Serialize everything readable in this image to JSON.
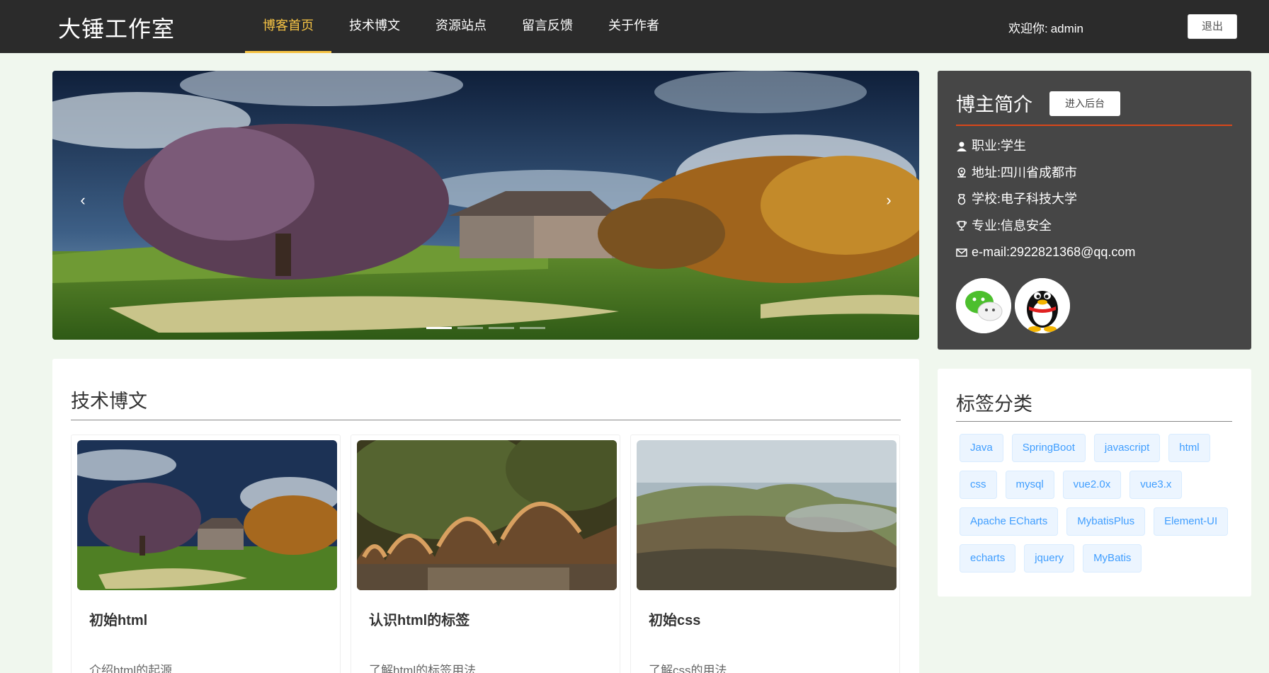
{
  "header": {
    "brand": "大锤工作室",
    "nav": [
      "博客首页",
      "技术博文",
      "资源站点",
      "留言反馈",
      "关于作者"
    ],
    "active_index": 0,
    "welcome_label": "欢迎你:",
    "username": "admin",
    "logout_label": "退出",
    "accent_color": "#f6c344"
  },
  "carousel": {
    "prev_glyph": "‹",
    "next_glyph": "›",
    "slides": 4,
    "active_slide": 1
  },
  "profile": {
    "title": "博主简介",
    "admin_button": "进入后台",
    "items": [
      {
        "icon": "user-icon",
        "text": "职业:学生"
      },
      {
        "icon": "location-icon",
        "text": "地址:四川省成都市"
      },
      {
        "icon": "medal-icon",
        "text": "学校:电子科技大学"
      },
      {
        "icon": "trophy-icon",
        "text": "专业:信息安全"
      },
      {
        "icon": "mail-icon",
        "text": "e-mail:2922821368@qq.com"
      }
    ],
    "social": [
      "wechat-icon",
      "qq-icon"
    ]
  },
  "articles": {
    "title": "技术博文",
    "cards": [
      {
        "title": "初始html",
        "desc": "介绍html的起源"
      },
      {
        "title": "认识html的标签",
        "desc": "了解html的标签用法"
      },
      {
        "title": "初始css",
        "desc": "了解css的用法"
      }
    ]
  },
  "tags": {
    "title": "标签分类",
    "items": [
      "Java",
      "SpringBoot",
      "javascript",
      "html",
      "css",
      "mysql",
      "vue2.0x",
      "vue3.x",
      "Apache ECharts",
      "MybatisPlus",
      "Element-UI",
      "echarts",
      "jquery",
      "MyBatis"
    ]
  }
}
